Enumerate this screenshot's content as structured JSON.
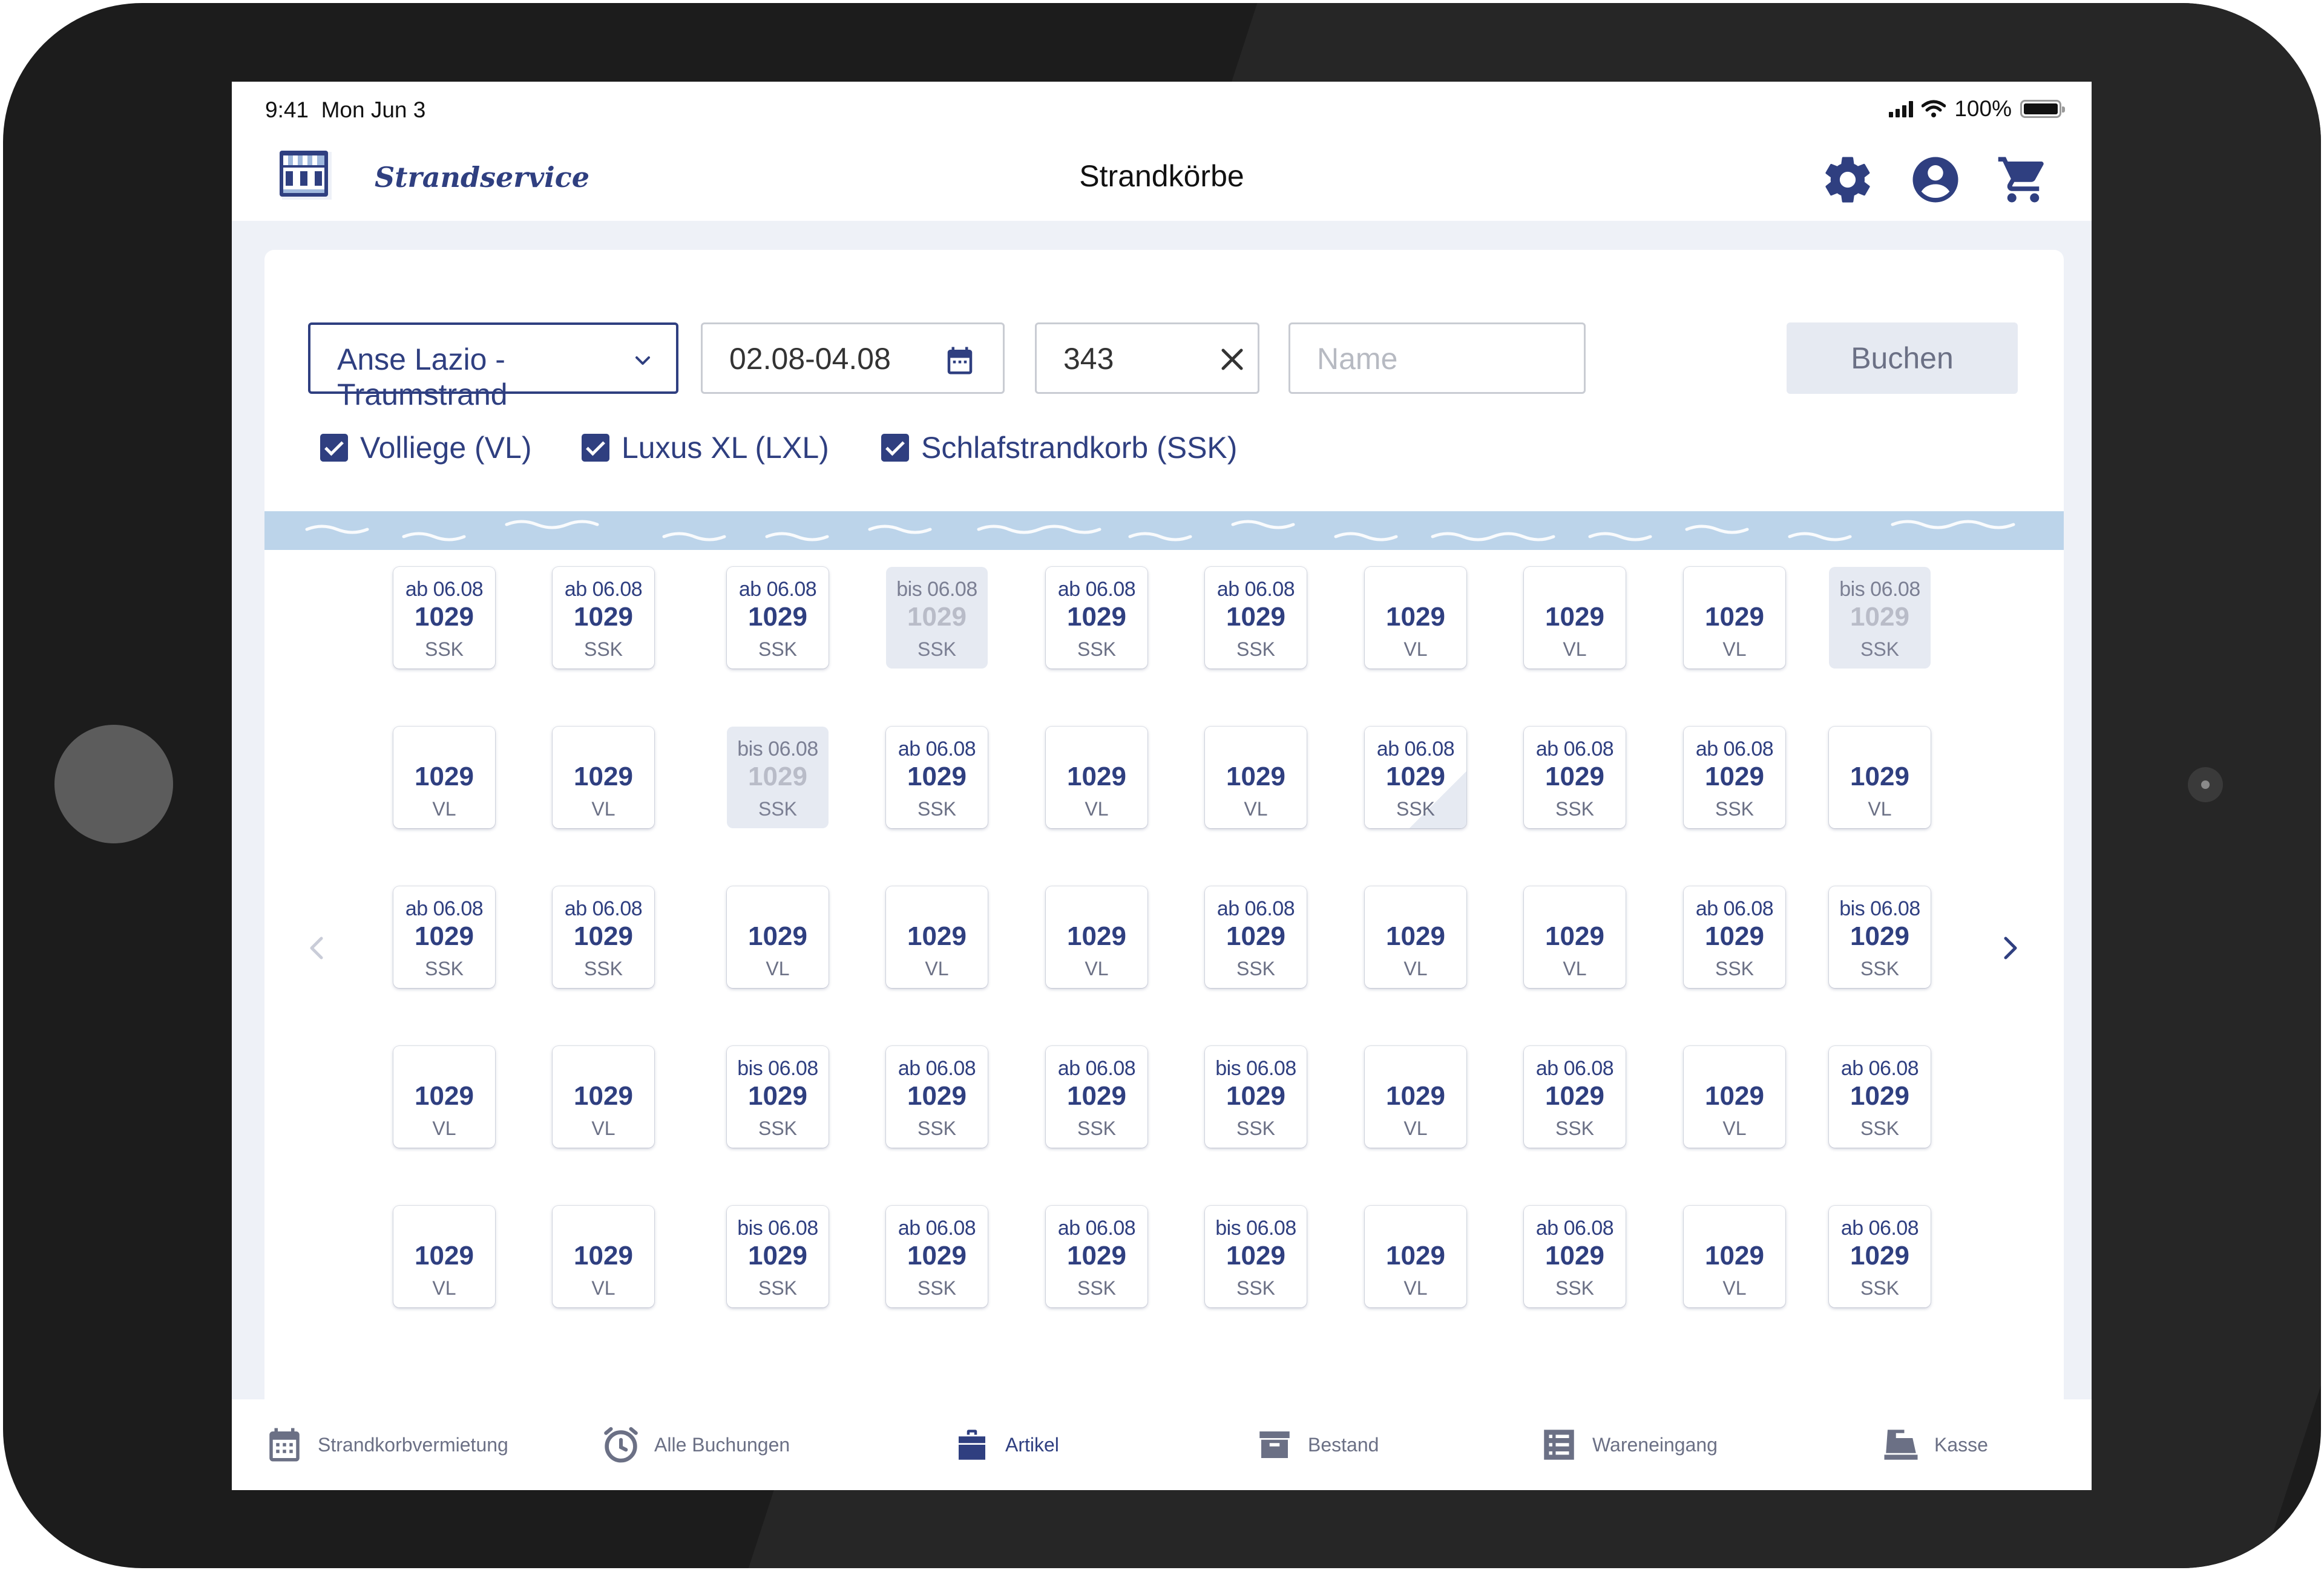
{
  "status_bar": {
    "time": "9:41",
    "date": "Mon Jun 3",
    "battery": "100%"
  },
  "header": {
    "brand": "Strandservice",
    "title": "Strandkörbe"
  },
  "filters": {
    "location": "Anse Lazio - Traumstrand",
    "date_range": "02.08-04.08",
    "number_value": "343",
    "name_placeholder": "Name",
    "book_button": "Buchen"
  },
  "checkboxes": [
    {
      "label": "Volliege (VL)",
      "checked": true
    },
    {
      "label": "Luxus XL (LXL)",
      "checked": true
    },
    {
      "label": "Schlafstrandkorb (SSK)",
      "checked": true
    }
  ],
  "grid": {
    "rows": [
      [
        {
          "note": "ab 06.08",
          "number": "1029",
          "kind": "SSK",
          "state": "normal"
        },
        {
          "note": "ab 06.08",
          "number": "1029",
          "kind": "SSK",
          "state": "normal"
        },
        {
          "note": "ab 06.08",
          "number": "1029",
          "kind": "SSK",
          "state": "normal"
        },
        {
          "note": "bis 06.08",
          "number": "1029",
          "kind": "SSK",
          "state": "booked"
        },
        {
          "note": "ab 06.08",
          "number": "1029",
          "kind": "SSK",
          "state": "normal"
        },
        {
          "note": "ab 06.08",
          "number": "1029",
          "kind": "SSK",
          "state": "normal"
        },
        {
          "note": "",
          "number": "1029",
          "kind": "VL",
          "state": "normal"
        },
        {
          "note": "",
          "number": "1029",
          "kind": "VL",
          "state": "normal"
        },
        {
          "note": "",
          "number": "1029",
          "kind": "VL",
          "state": "normal"
        },
        {
          "note": "bis 06.08",
          "number": "1029",
          "kind": "SSK",
          "state": "booked"
        }
      ],
      [
        {
          "note": "",
          "number": "1029",
          "kind": "VL",
          "state": "normal"
        },
        {
          "note": "",
          "number": "1029",
          "kind": "VL",
          "state": "normal"
        },
        {
          "note": "bis 06.08",
          "number": "1029",
          "kind": "SSK",
          "state": "booked"
        },
        {
          "note": "ab 06.08",
          "number": "1029",
          "kind": "SSK",
          "state": "normal"
        },
        {
          "note": "",
          "number": "1029",
          "kind": "VL",
          "state": "normal"
        },
        {
          "note": "",
          "number": "1029",
          "kind": "VL",
          "state": "normal"
        },
        {
          "note": "ab 06.08",
          "number": "1029",
          "kind": "SSK",
          "state": "partial"
        },
        {
          "note": "ab 06.08",
          "number": "1029",
          "kind": "SSK",
          "state": "normal"
        },
        {
          "note": "ab 06.08",
          "number": "1029",
          "kind": "SSK",
          "state": "normal"
        },
        {
          "note": "",
          "number": "1029",
          "kind": "VL",
          "state": "normal"
        }
      ],
      [
        {
          "note": "ab 06.08",
          "number": "1029",
          "kind": "SSK",
          "state": "normal"
        },
        {
          "note": "ab 06.08",
          "number": "1029",
          "kind": "SSK",
          "state": "normal"
        },
        {
          "note": "",
          "number": "1029",
          "kind": "VL",
          "state": "normal"
        },
        {
          "note": "",
          "number": "1029",
          "kind": "VL",
          "state": "normal"
        },
        {
          "note": "",
          "number": "1029",
          "kind": "VL",
          "state": "normal"
        },
        {
          "note": "ab 06.08",
          "number": "1029",
          "kind": "SSK",
          "state": "normal"
        },
        {
          "note": "",
          "number": "1029",
          "kind": "VL",
          "state": "normal"
        },
        {
          "note": "",
          "number": "1029",
          "kind": "VL",
          "state": "normal"
        },
        {
          "note": "ab 06.08",
          "number": "1029",
          "kind": "SSK",
          "state": "normal"
        },
        {
          "note": "bis 06.08",
          "number": "1029",
          "kind": "SSK",
          "state": "normal"
        }
      ],
      [
        {
          "note": "",
          "number": "1029",
          "kind": "VL",
          "state": "normal"
        },
        {
          "note": "",
          "number": "1029",
          "kind": "VL",
          "state": "normal"
        },
        {
          "note": "bis 06.08",
          "number": "1029",
          "kind": "SSK",
          "state": "normal"
        },
        {
          "note": "ab 06.08",
          "number": "1029",
          "kind": "SSK",
          "state": "normal"
        },
        {
          "note": "ab 06.08",
          "number": "1029",
          "kind": "SSK",
          "state": "normal"
        },
        {
          "note": "bis 06.08",
          "number": "1029",
          "kind": "SSK",
          "state": "normal"
        },
        {
          "note": "",
          "number": "1029",
          "kind": "VL",
          "state": "normal"
        },
        {
          "note": "ab 06.08",
          "number": "1029",
          "kind": "SSK",
          "state": "normal"
        },
        {
          "note": "",
          "number": "1029",
          "kind": "VL",
          "state": "normal"
        },
        {
          "note": "ab 06.08",
          "number": "1029",
          "kind": "SSK",
          "state": "normal"
        }
      ],
      [
        {
          "note": "",
          "number": "1029",
          "kind": "VL",
          "state": "normal"
        },
        {
          "note": "",
          "number": "1029",
          "kind": "VL",
          "state": "normal"
        },
        {
          "note": "bis 06.08",
          "number": "1029",
          "kind": "SSK",
          "state": "normal"
        },
        {
          "note": "ab 06.08",
          "number": "1029",
          "kind": "SSK",
          "state": "normal"
        },
        {
          "note": "ab 06.08",
          "number": "1029",
          "kind": "SSK",
          "state": "normal"
        },
        {
          "note": "bis 06.08",
          "number": "1029",
          "kind": "SSK",
          "state": "normal"
        },
        {
          "note": "",
          "number": "1029",
          "kind": "VL",
          "state": "normal"
        },
        {
          "note": "ab 06.08",
          "number": "1029",
          "kind": "SSK",
          "state": "normal"
        },
        {
          "note": "",
          "number": "1029",
          "kind": "VL",
          "state": "normal"
        },
        {
          "note": "ab 06.08",
          "number": "1029",
          "kind": "SSK",
          "state": "normal"
        }
      ]
    ]
  },
  "tabs": [
    {
      "label": "Strandkorbvermietung",
      "icon": "calendar-icon",
      "active": false
    },
    {
      "label": "Alle Buchungen",
      "icon": "clock-icon",
      "active": false
    },
    {
      "label": "Artikel",
      "icon": "bag-icon",
      "active": true
    },
    {
      "label": "Bestand",
      "icon": "archive-icon",
      "active": false
    },
    {
      "label": "Wareneingang",
      "icon": "list-icon",
      "active": false
    },
    {
      "label": "Kasse",
      "icon": "register-icon",
      "active": false
    }
  ],
  "colors": {
    "primary": "#2f3f80",
    "water": "#bcd4ea",
    "booked_tile": "#e6eaf2",
    "background": "#eef1f7"
  }
}
